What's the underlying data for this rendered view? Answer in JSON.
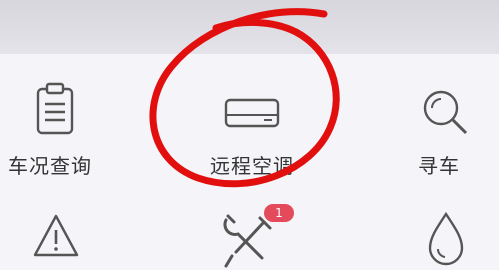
{
  "services": [
    {
      "label": "车况查询",
      "icon": "clipboard-icon"
    },
    {
      "label": "远程空调",
      "icon": "air-conditioner-icon"
    },
    {
      "label": "寻车",
      "icon": "search-icon"
    },
    {
      "label": "",
      "icon": "warning-triangle-icon"
    },
    {
      "label": "",
      "icon": "wrench-screwdriver-icon",
      "badge": "1"
    },
    {
      "label": "",
      "icon": "water-drop-icon"
    }
  ],
  "colors": {
    "icon": "#555555",
    "badge": "#e34a5b",
    "annotation": "#e1100f"
  }
}
